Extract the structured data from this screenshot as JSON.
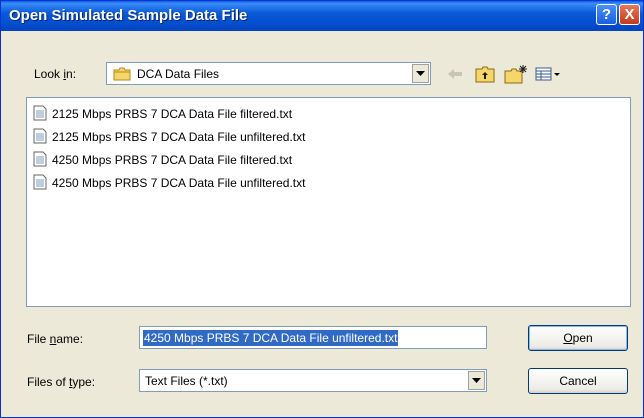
{
  "window": {
    "title": "Open Simulated Sample Data File",
    "help_label": "?",
    "close_label": "X"
  },
  "lookin": {
    "label_pre": "Look ",
    "label_key": "i",
    "label_post": "n:",
    "value": "DCA Data Files"
  },
  "files": [
    {
      "name": "2125 Mbps PRBS 7 DCA Data File filtered.txt"
    },
    {
      "name": "2125 Mbps PRBS 7 DCA Data File unfiltered.txt"
    },
    {
      "name": "4250 Mbps PRBS 7 DCA Data File filtered.txt"
    },
    {
      "name": "4250 Mbps PRBS 7 DCA Data File unfiltered.txt"
    }
  ],
  "filename": {
    "label_pre": "File ",
    "label_key": "n",
    "label_post": "ame:",
    "value": "4250 Mbps PRBS 7 DCA Data File unfiltered.txt"
  },
  "filetype": {
    "label_pre": "Files of ",
    "label_key": "t",
    "label_post": "ype:",
    "value": "Text Files (*.txt)"
  },
  "buttons": {
    "open_key": "O",
    "open_rest": "pen",
    "cancel": "Cancel"
  },
  "colors": {
    "titlebar": "#0550d0",
    "selection": "#316ac5",
    "face": "#ece9d8"
  }
}
